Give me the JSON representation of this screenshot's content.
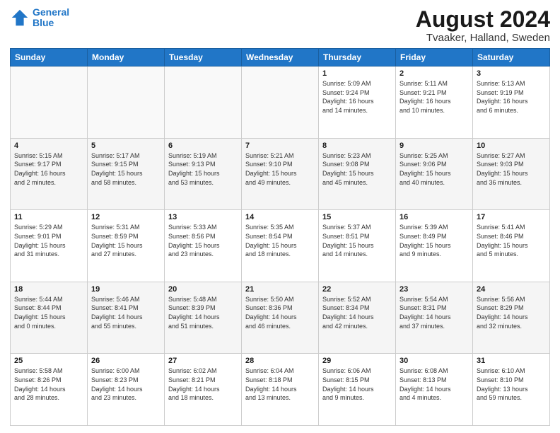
{
  "logo": {
    "line1": "General",
    "line2": "Blue"
  },
  "title": "August 2024",
  "location": "Tvaaker, Halland, Sweden",
  "headers": [
    "Sunday",
    "Monday",
    "Tuesday",
    "Wednesday",
    "Thursday",
    "Friday",
    "Saturday"
  ],
  "weeks": [
    [
      {
        "day": "",
        "info": ""
      },
      {
        "day": "",
        "info": ""
      },
      {
        "day": "",
        "info": ""
      },
      {
        "day": "",
        "info": ""
      },
      {
        "day": "1",
        "info": "Sunrise: 5:09 AM\nSunset: 9:24 PM\nDaylight: 16 hours\nand 14 minutes."
      },
      {
        "day": "2",
        "info": "Sunrise: 5:11 AM\nSunset: 9:21 PM\nDaylight: 16 hours\nand 10 minutes."
      },
      {
        "day": "3",
        "info": "Sunrise: 5:13 AM\nSunset: 9:19 PM\nDaylight: 16 hours\nand 6 minutes."
      }
    ],
    [
      {
        "day": "4",
        "info": "Sunrise: 5:15 AM\nSunset: 9:17 PM\nDaylight: 16 hours\nand 2 minutes."
      },
      {
        "day": "5",
        "info": "Sunrise: 5:17 AM\nSunset: 9:15 PM\nDaylight: 15 hours\nand 58 minutes."
      },
      {
        "day": "6",
        "info": "Sunrise: 5:19 AM\nSunset: 9:13 PM\nDaylight: 15 hours\nand 53 minutes."
      },
      {
        "day": "7",
        "info": "Sunrise: 5:21 AM\nSunset: 9:10 PM\nDaylight: 15 hours\nand 49 minutes."
      },
      {
        "day": "8",
        "info": "Sunrise: 5:23 AM\nSunset: 9:08 PM\nDaylight: 15 hours\nand 45 minutes."
      },
      {
        "day": "9",
        "info": "Sunrise: 5:25 AM\nSunset: 9:06 PM\nDaylight: 15 hours\nand 40 minutes."
      },
      {
        "day": "10",
        "info": "Sunrise: 5:27 AM\nSunset: 9:03 PM\nDaylight: 15 hours\nand 36 minutes."
      }
    ],
    [
      {
        "day": "11",
        "info": "Sunrise: 5:29 AM\nSunset: 9:01 PM\nDaylight: 15 hours\nand 31 minutes."
      },
      {
        "day": "12",
        "info": "Sunrise: 5:31 AM\nSunset: 8:59 PM\nDaylight: 15 hours\nand 27 minutes."
      },
      {
        "day": "13",
        "info": "Sunrise: 5:33 AM\nSunset: 8:56 PM\nDaylight: 15 hours\nand 23 minutes."
      },
      {
        "day": "14",
        "info": "Sunrise: 5:35 AM\nSunset: 8:54 PM\nDaylight: 15 hours\nand 18 minutes."
      },
      {
        "day": "15",
        "info": "Sunrise: 5:37 AM\nSunset: 8:51 PM\nDaylight: 15 hours\nand 14 minutes."
      },
      {
        "day": "16",
        "info": "Sunrise: 5:39 AM\nSunset: 8:49 PM\nDaylight: 15 hours\nand 9 minutes."
      },
      {
        "day": "17",
        "info": "Sunrise: 5:41 AM\nSunset: 8:46 PM\nDaylight: 15 hours\nand 5 minutes."
      }
    ],
    [
      {
        "day": "18",
        "info": "Sunrise: 5:44 AM\nSunset: 8:44 PM\nDaylight: 15 hours\nand 0 minutes."
      },
      {
        "day": "19",
        "info": "Sunrise: 5:46 AM\nSunset: 8:41 PM\nDaylight: 14 hours\nand 55 minutes."
      },
      {
        "day": "20",
        "info": "Sunrise: 5:48 AM\nSunset: 8:39 PM\nDaylight: 14 hours\nand 51 minutes."
      },
      {
        "day": "21",
        "info": "Sunrise: 5:50 AM\nSunset: 8:36 PM\nDaylight: 14 hours\nand 46 minutes."
      },
      {
        "day": "22",
        "info": "Sunrise: 5:52 AM\nSunset: 8:34 PM\nDaylight: 14 hours\nand 42 minutes."
      },
      {
        "day": "23",
        "info": "Sunrise: 5:54 AM\nSunset: 8:31 PM\nDaylight: 14 hours\nand 37 minutes."
      },
      {
        "day": "24",
        "info": "Sunrise: 5:56 AM\nSunset: 8:29 PM\nDaylight: 14 hours\nand 32 minutes."
      }
    ],
    [
      {
        "day": "25",
        "info": "Sunrise: 5:58 AM\nSunset: 8:26 PM\nDaylight: 14 hours\nand 28 minutes."
      },
      {
        "day": "26",
        "info": "Sunrise: 6:00 AM\nSunset: 8:23 PM\nDaylight: 14 hours\nand 23 minutes."
      },
      {
        "day": "27",
        "info": "Sunrise: 6:02 AM\nSunset: 8:21 PM\nDaylight: 14 hours\nand 18 minutes."
      },
      {
        "day": "28",
        "info": "Sunrise: 6:04 AM\nSunset: 8:18 PM\nDaylight: 14 hours\nand 13 minutes."
      },
      {
        "day": "29",
        "info": "Sunrise: 6:06 AM\nSunset: 8:15 PM\nDaylight: 14 hours\nand 9 minutes."
      },
      {
        "day": "30",
        "info": "Sunrise: 6:08 AM\nSunset: 8:13 PM\nDaylight: 14 hours\nand 4 minutes."
      },
      {
        "day": "31",
        "info": "Sunrise: 6:10 AM\nSunset: 8:10 PM\nDaylight: 13 hours\nand 59 minutes."
      }
    ]
  ]
}
